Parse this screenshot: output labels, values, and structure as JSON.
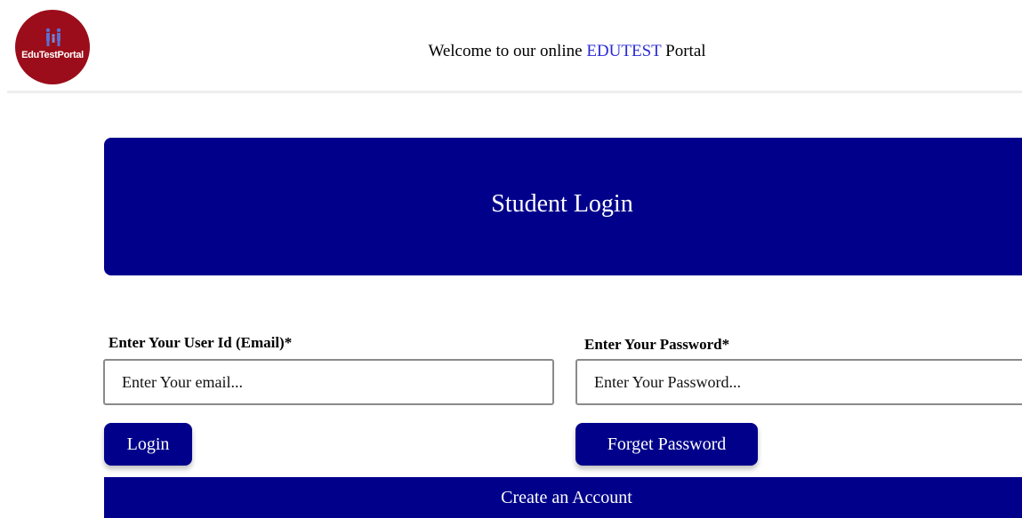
{
  "header": {
    "logo": {
      "text": "EduTestPortal",
      "background": "#9b0d1a",
      "icon": "people-icon"
    },
    "welcome": {
      "prefix": "Welcome to our online ",
      "brand": "EDUTEST",
      "suffix": " Portal",
      "brand_color": "#2b2bd6"
    }
  },
  "banner": {
    "title": "Student Login",
    "background": "#00008b"
  },
  "form": {
    "email": {
      "label": "Enter Your User Id (Email)*",
      "placeholder": "Enter Your email...",
      "value": ""
    },
    "password": {
      "label": "Enter Your Password*",
      "placeholder": "Enter Your Password...",
      "value": ""
    },
    "login_button": "Login",
    "forget_button": "Forget Password",
    "create_account_button": "Create an Account"
  }
}
